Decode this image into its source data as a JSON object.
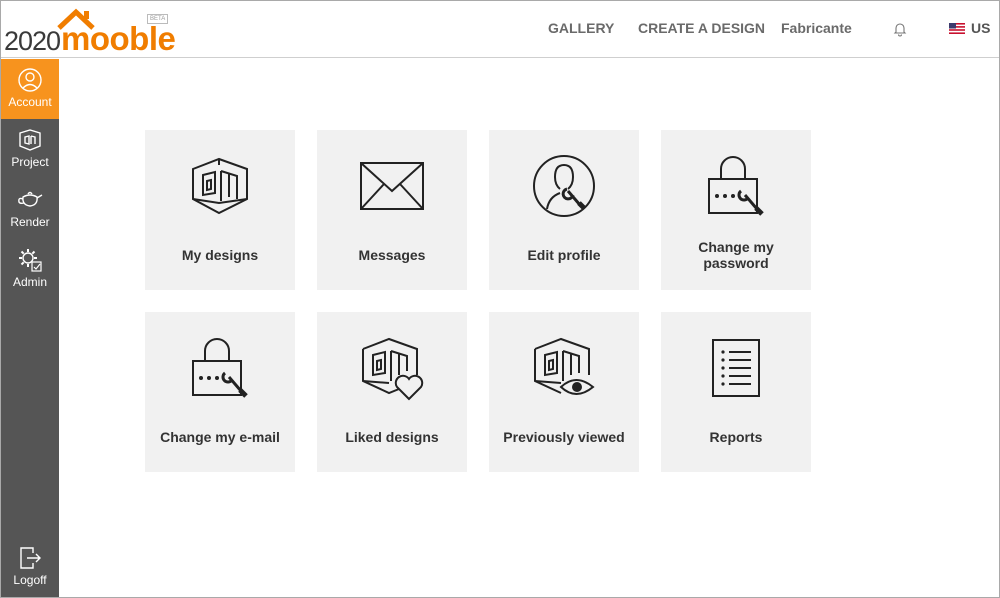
{
  "header": {
    "logo_num": "2020",
    "logo_word": "mooble",
    "logo_beta": "BETA",
    "nav": {
      "gallery": "GALLERY",
      "create": "CREATE A DESIGN",
      "user": "Fabricante"
    },
    "language": "US"
  },
  "sidebar": {
    "items": [
      {
        "label": "Account",
        "icon": "user-circle-icon",
        "active": true
      },
      {
        "label": "Project",
        "icon": "room-box-icon"
      },
      {
        "label": "Render",
        "icon": "teapot-icon"
      },
      {
        "label": "Admin",
        "icon": "gear-admin-icon"
      }
    ],
    "logoff": "Logoff"
  },
  "tiles": [
    {
      "label": "My designs",
      "icon": "room-box-icon"
    },
    {
      "label": "Messages",
      "icon": "envelope-icon"
    },
    {
      "label": "Edit profile",
      "icon": "profile-wrench-icon"
    },
    {
      "label": "Change my password",
      "icon": "lock-wrench-icon"
    },
    {
      "label": "Change my e-mail",
      "icon": "lock-wrench-icon"
    },
    {
      "label": "Liked designs",
      "icon": "room-heart-icon"
    },
    {
      "label": "Previously viewed",
      "icon": "room-eye-icon"
    },
    {
      "label": "Reports",
      "icon": "report-list-icon"
    }
  ],
  "colors": {
    "accent": "#f7931e",
    "logo_orange": "#f07d00",
    "sidebar": "#555555",
    "tile_bg": "#f1f1f1"
  }
}
